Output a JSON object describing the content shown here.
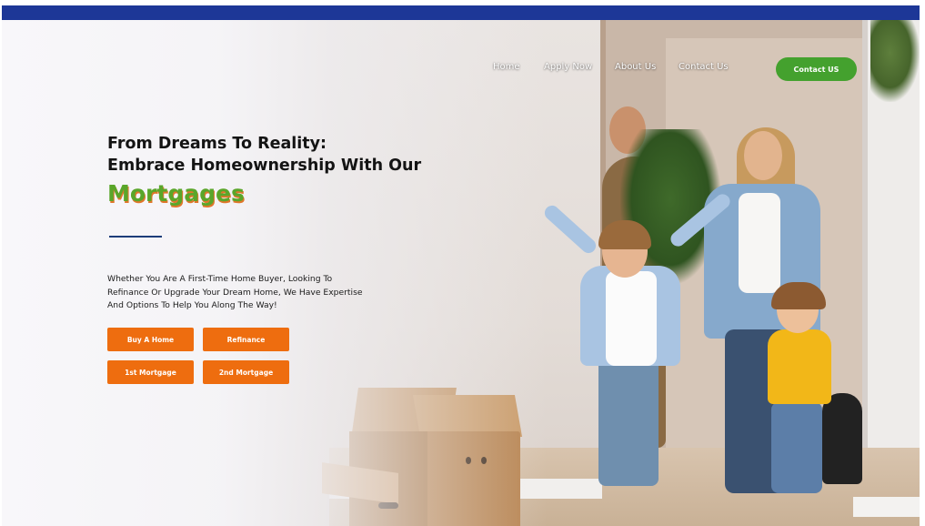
{
  "colors": {
    "top_strip": "#1d3797",
    "nav_text": "#ffffff",
    "contact_button": "#44a12e",
    "accent_green": "#5aa62a",
    "accent_shadow": "#e0762a",
    "cta_orange": "#ee6d0f",
    "divider": "#1d3d7a"
  },
  "nav": {
    "links": [
      "Home",
      "Apply Now",
      "About Us",
      "Contact Us"
    ],
    "contact_button": "Contact US"
  },
  "hero": {
    "headline_line1": "From Dreams To Reality:",
    "headline_line2": "Embrace Homeownership With Our",
    "accent_word": "Mortgages",
    "description": "Whether You Are A First-Time Home Buyer, Looking To Refinance Or Upgrade Your Dream Home, We Have Expertise And Options To Help You Along The Way!",
    "buttons": [
      "Buy A Home",
      "Refinance",
      "1st Mortgage",
      "2nd Mortgage"
    ]
  }
}
